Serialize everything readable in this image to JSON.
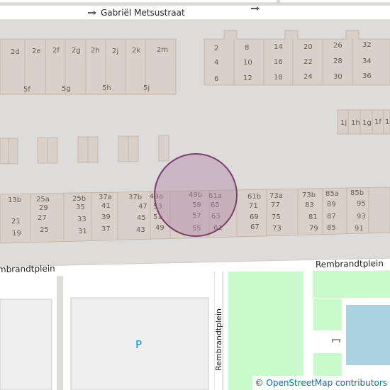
{
  "map": {
    "streets": {
      "top": "Gabriël Metsustraat",
      "bottom_left": "mbrandtplein",
      "bottom_right": "Rembrandtplein",
      "vertical": "Rembrandtplein"
    },
    "parking_label": "P",
    "house_numbers": {
      "row1": [
        "2d",
        "2e",
        "2f",
        "2g",
        "2h",
        "2j",
        "2k",
        "2m"
      ],
      "row1b": [
        "5f",
        "5g",
        "5h",
        "5j"
      ],
      "right_block": [
        "2",
        "8",
        "14",
        "20",
        "26",
        "32",
        "4",
        "10",
        "16",
        "22",
        "28",
        "34",
        "6",
        "12",
        "18",
        "24",
        "30",
        "36"
      ],
      "small_right": [
        "1j",
        "1h",
        "1g",
        "1f",
        "1"
      ],
      "bottom_row": [
        "13b",
        "25a",
        "25b",
        "37a",
        "37b",
        "49a",
        "49b",
        "61a",
        "61b",
        "73a",
        "73b",
        "85a",
        "85b",
        "29",
        "35",
        "41",
        "47",
        "53",
        "59",
        "65",
        "71",
        "77",
        "83",
        "89",
        "95",
        "21",
        "27",
        "33",
        "39",
        "45",
        "51",
        "57",
        "63",
        "69",
        "75",
        "81",
        "87",
        "93",
        "19",
        "25",
        "31",
        "37",
        "43",
        "49",
        "55",
        "61",
        "67",
        "73",
        "79",
        "85",
        "91"
      ]
    },
    "colors": {
      "background": "#dedcdb",
      "building": "#d9d0c9",
      "building_stroke": "#c4b6ab",
      "road": "#ffffff",
      "park": "#c8facc",
      "water": "#aad3df",
      "marker_fill": "#b48aa8",
      "marker_stroke": "#7a3e6f",
      "parking_text": "#0092da"
    }
  },
  "attribution": {
    "symbol": "©",
    "text": "OpenStreetMap contributors"
  }
}
